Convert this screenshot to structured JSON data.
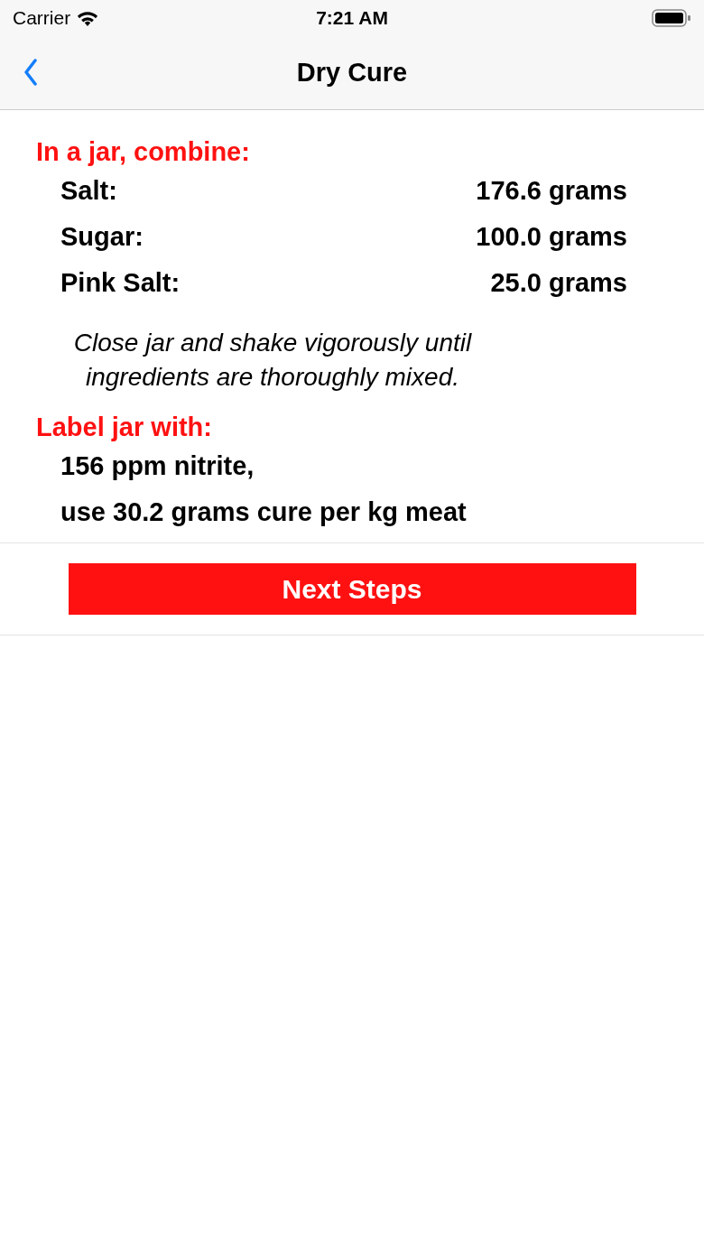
{
  "status_bar": {
    "carrier": "Carrier",
    "time": "7:21 AM"
  },
  "nav": {
    "title": "Dry Cure"
  },
  "combine": {
    "heading": "In a jar, combine:",
    "items": [
      {
        "name": "Salt:",
        "amount": "176.6 grams"
      },
      {
        "name": "Sugar:",
        "amount": "100.0 grams"
      },
      {
        "name": "Pink Salt:",
        "amount": "25.0 grams"
      }
    ]
  },
  "instruction": "Close jar and shake vigorously until ingredients are thoroughly mixed.",
  "label": {
    "heading": "Label jar with:",
    "lines": [
      "156 ppm nitrite,",
      "use 30.2 grams cure per kg meat"
    ]
  },
  "button": "Next Steps"
}
